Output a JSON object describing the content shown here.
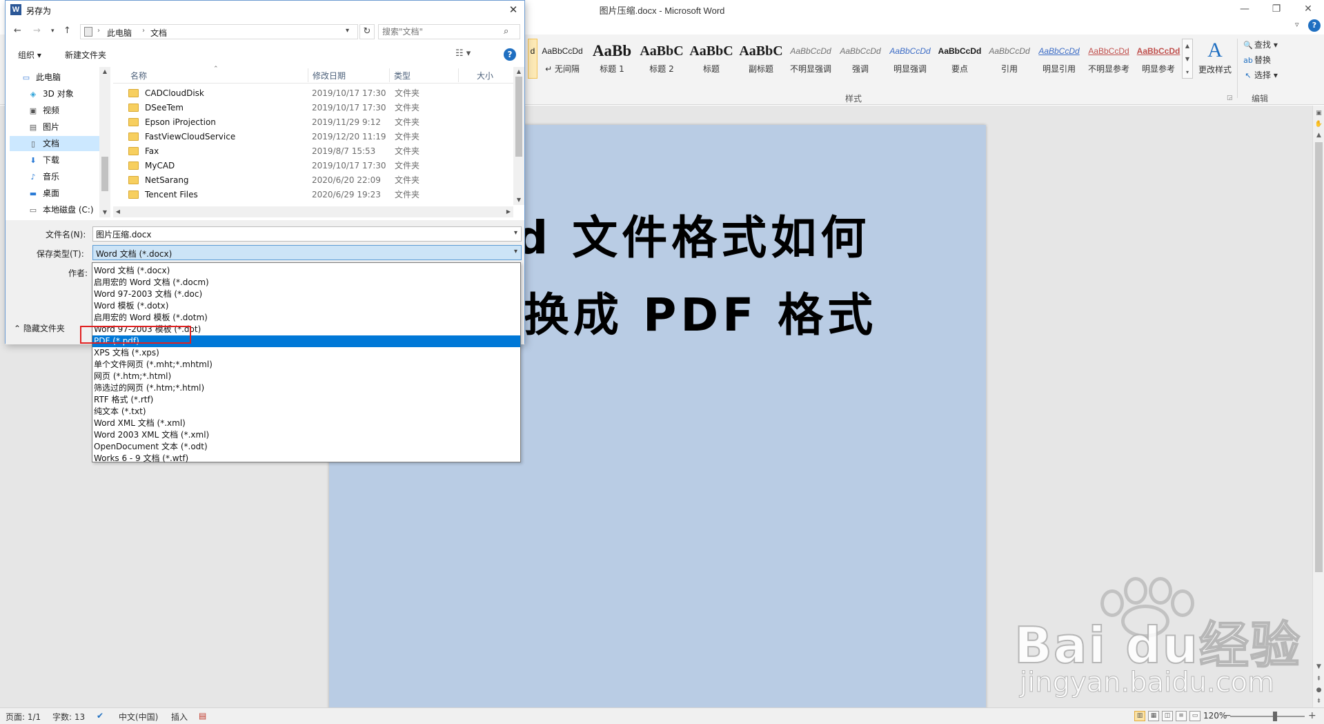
{
  "word": {
    "title": "图片压缩.docx - Microsoft Word",
    "window_controls": {
      "minimize": "—",
      "restore": "❐",
      "close": "✕"
    },
    "help_icon": "?",
    "ribbon": {
      "styles": [
        {
          "sample": "AaBbCcDd",
          "name": "↵ 无间隔"
        },
        {
          "sample": "AaBb",
          "name": "标题 1"
        },
        {
          "sample": "AaBbC",
          "name": "标题 2"
        },
        {
          "sample": "AaBbC",
          "name": "标题"
        },
        {
          "sample": "AaBbC",
          "name": "副标题"
        },
        {
          "sample": "AaBbCcDd",
          "name": "不明显强调"
        },
        {
          "sample": "AaBbCcDd",
          "name": "强调"
        },
        {
          "sample": "AaBbCcDd",
          "name": "明显强调"
        },
        {
          "sample": "AaBbCcDd",
          "name": "要点"
        },
        {
          "sample": "AaBbCcDd",
          "name": "引用"
        },
        {
          "sample": "AaBbCcDd",
          "name": "明显引用"
        },
        {
          "sample": "AaBbCcDd",
          "name": "不明显参考"
        },
        {
          "sample": "AaBbCcDd",
          "name": "明显参考"
        }
      ],
      "current_style_sample": "d",
      "change_styles": {
        "icon": "A",
        "label": "更改样式"
      },
      "edit": {
        "find": "查找",
        "replace": "替换",
        "select": "选择"
      },
      "group_styles": "样式",
      "group_edit": "编辑"
    },
    "document": {
      "line1": "d 文件格式如何",
      "line2": "换成 PDF 格式"
    },
    "status": {
      "page": "页面: 1/1",
      "words": "字数: 13",
      "language": "中文(中国)",
      "mode": "插入",
      "zoom": "120%",
      "zoom_level": 0.6
    }
  },
  "dialog": {
    "title": "另存为",
    "icon_letter": "W",
    "breadcrumb": [
      "此电脑",
      "文档"
    ],
    "search_placeholder": "搜索\"文档\"",
    "toolbar": {
      "organize": "组织 ▾",
      "new_folder": "新建文件夹"
    },
    "nav_items": [
      {
        "label": "此电脑",
        "icon": "computer-icon",
        "root": true
      },
      {
        "label": "3D 对象",
        "icon": "cube-icon"
      },
      {
        "label": "视频",
        "icon": "video-icon"
      },
      {
        "label": "图片",
        "icon": "picture-icon"
      },
      {
        "label": "文档",
        "icon": "document-icon",
        "selected": true
      },
      {
        "label": "下载",
        "icon": "download-icon"
      },
      {
        "label": "音乐",
        "icon": "music-icon"
      },
      {
        "label": "桌面",
        "icon": "desktop-icon"
      },
      {
        "label": "本地磁盘 (C:)",
        "icon": "drive-icon"
      }
    ],
    "columns": {
      "name": "名称",
      "date": "修改日期",
      "type": "类型",
      "size": "大小"
    },
    "files": [
      {
        "name": "CADCloudDisk",
        "date": "2019/10/17 17:30",
        "type": "文件夹"
      },
      {
        "name": "DSeeTem",
        "date": "2019/10/17 17:30",
        "type": "文件夹"
      },
      {
        "name": "Epson iProjection",
        "date": "2019/11/29 9:12",
        "type": "文件夹"
      },
      {
        "name": "FastViewCloudService",
        "date": "2019/12/20 11:19",
        "type": "文件夹"
      },
      {
        "name": "Fax",
        "date": "2019/8/7 15:53",
        "type": "文件夹"
      },
      {
        "name": "MyCAD",
        "date": "2019/10/17 17:30",
        "type": "文件夹"
      },
      {
        "name": "NetSarang",
        "date": "2020/6/20 22:09",
        "type": "文件夹"
      },
      {
        "name": "Tencent Files",
        "date": "2020/6/29 19:23",
        "type": "文件夹"
      }
    ],
    "filename_label": "文件名(N):",
    "filename_value": "图片压缩.docx",
    "savetype_label": "保存类型(T):",
    "savetype_value": "Word 文档 (*.docx)",
    "author_label": "作者:",
    "hide_folders": "隐藏文件夹",
    "save_types": [
      "Word 文档 (*.docx)",
      "启用宏的 Word 文档 (*.docm)",
      "Word 97-2003 文档 (*.doc)",
      "Word 模板 (*.dotx)",
      "启用宏的 Word 模板 (*.dotm)",
      "Word 97-2003 模板 (*.dot)",
      "PDF (*.pdf)",
      "XPS 文档 (*.xps)",
      "单个文件网页 (*.mht;*.mhtml)",
      "网页 (*.htm;*.html)",
      "筛选过的网页 (*.htm;*.html)",
      "RTF 格式 (*.rtf)",
      "纯文本 (*.txt)",
      "Word XML 文档 (*.xml)",
      "Word 2003 XML 文档 (*.xml)",
      "OpenDocument 文本 (*.odt)",
      "Works 6 - 9 文档 (*.wtf)"
    ],
    "selected_save_type_index": 6
  },
  "watermark": {
    "brand": "Bai du经验",
    "url": "jingyan.baidu.com"
  },
  "colors": {
    "accent": "#0078d7",
    "highlight_box": "#e02020",
    "page": "#b9cce4"
  }
}
